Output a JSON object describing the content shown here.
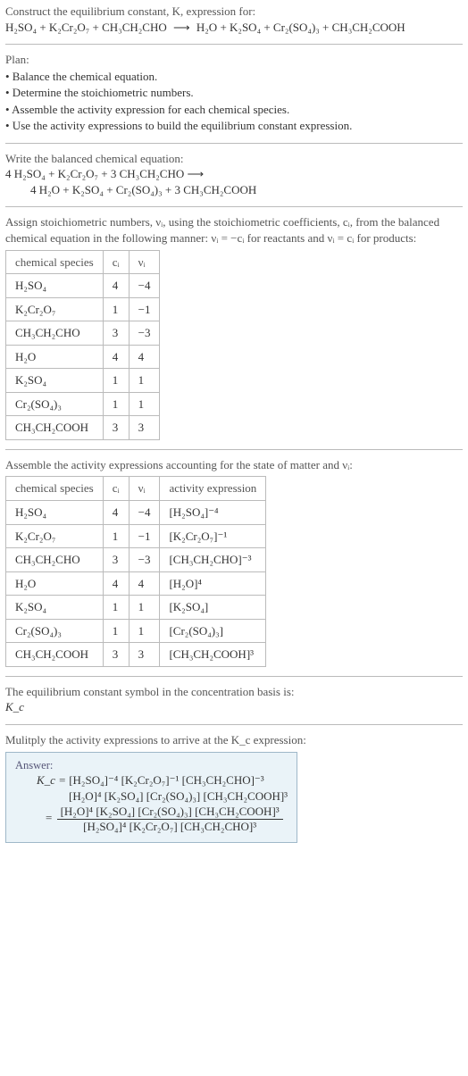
{
  "intro": {
    "line1": "Construct the equilibrium constant, K, expression for:",
    "equation_left": "H₂SO₄ + K₂Cr₂O₇ + CH₃CH₂CHO",
    "arrow": "⟶",
    "equation_right": "H₂O + K₂SO₄ + Cr₂(SO₄)₃ + CH₃CH₂COOH"
  },
  "plan": {
    "label": "Plan:",
    "items": [
      "• Balance the chemical equation.",
      "• Determine the stoichiometric numbers.",
      "• Assemble the activity expression for each chemical species.",
      "• Use the activity expressions to build the equilibrium constant expression."
    ]
  },
  "balanced": {
    "label": "Write the balanced chemical equation:",
    "line1": "4 H₂SO₄ + K₂Cr₂O₇ + 3 CH₃CH₂CHO ⟶",
    "line2": "4 H₂O + K₂SO₄ + Cr₂(SO₄)₃ + 3 CH₃CH₂COOH"
  },
  "stoich_intro": "Assign stoichiometric numbers, νᵢ, using the stoichiometric coefficients, cᵢ, from the balanced chemical equation in the following manner: νᵢ = −cᵢ for reactants and νᵢ = cᵢ for products:",
  "table1": {
    "headers": [
      "chemical species",
      "cᵢ",
      "νᵢ"
    ],
    "rows": [
      [
        "H₂SO₄",
        "4",
        "−4"
      ],
      [
        "K₂Cr₂O₇",
        "1",
        "−1"
      ],
      [
        "CH₃CH₂CHO",
        "3",
        "−3"
      ],
      [
        "H₂O",
        "4",
        "4"
      ],
      [
        "K₂SO₄",
        "1",
        "1"
      ],
      [
        "Cr₂(SO₄)₃",
        "1",
        "1"
      ],
      [
        "CH₃CH₂COOH",
        "3",
        "3"
      ]
    ]
  },
  "activity_intro": "Assemble the activity expressions accounting for the state of matter and νᵢ:",
  "table2": {
    "headers": [
      "chemical species",
      "cᵢ",
      "νᵢ",
      "activity expression"
    ],
    "rows": [
      [
        "H₂SO₄",
        "4",
        "−4",
        "[H₂SO₄]⁻⁴"
      ],
      [
        "K₂Cr₂O₇",
        "1",
        "−1",
        "[K₂Cr₂O₇]⁻¹"
      ],
      [
        "CH₃CH₂CHO",
        "3",
        "−3",
        "[CH₃CH₂CHO]⁻³"
      ],
      [
        "H₂O",
        "4",
        "4",
        "[H₂O]⁴"
      ],
      [
        "K₂SO₄",
        "1",
        "1",
        "[K₂SO₄]"
      ],
      [
        "Cr₂(SO₄)₃",
        "1",
        "1",
        "[Cr₂(SO₄)₃]"
      ],
      [
        "CH₃CH₂COOH",
        "3",
        "3",
        "[CH₃CH₂COOH]³"
      ]
    ]
  },
  "kc_symbol": {
    "line1": "The equilibrium constant symbol in the concentration basis is:",
    "line2": "K_c"
  },
  "multiply_line": "Mulitply the activity expressions to arrive at the K_c expression:",
  "answer": {
    "label": "Answer:",
    "prefix": "K_c =",
    "expr_line1": "[H₂SO₄]⁻⁴ [K₂Cr₂O₇]⁻¹ [CH₃CH₂CHO]⁻³",
    "expr_line2": "[H₂O]⁴ [K₂SO₄] [Cr₂(SO₄)₃] [CH₃CH₂COOH]³",
    "eq_sign": "=",
    "frac_num": "[H₂O]⁴ [K₂SO₄] [Cr₂(SO₄)₃] [CH₃CH₂COOH]³",
    "frac_den": "[H₂SO₄]⁴ [K₂Cr₂O₇] [CH₃CH₂CHO]³"
  }
}
